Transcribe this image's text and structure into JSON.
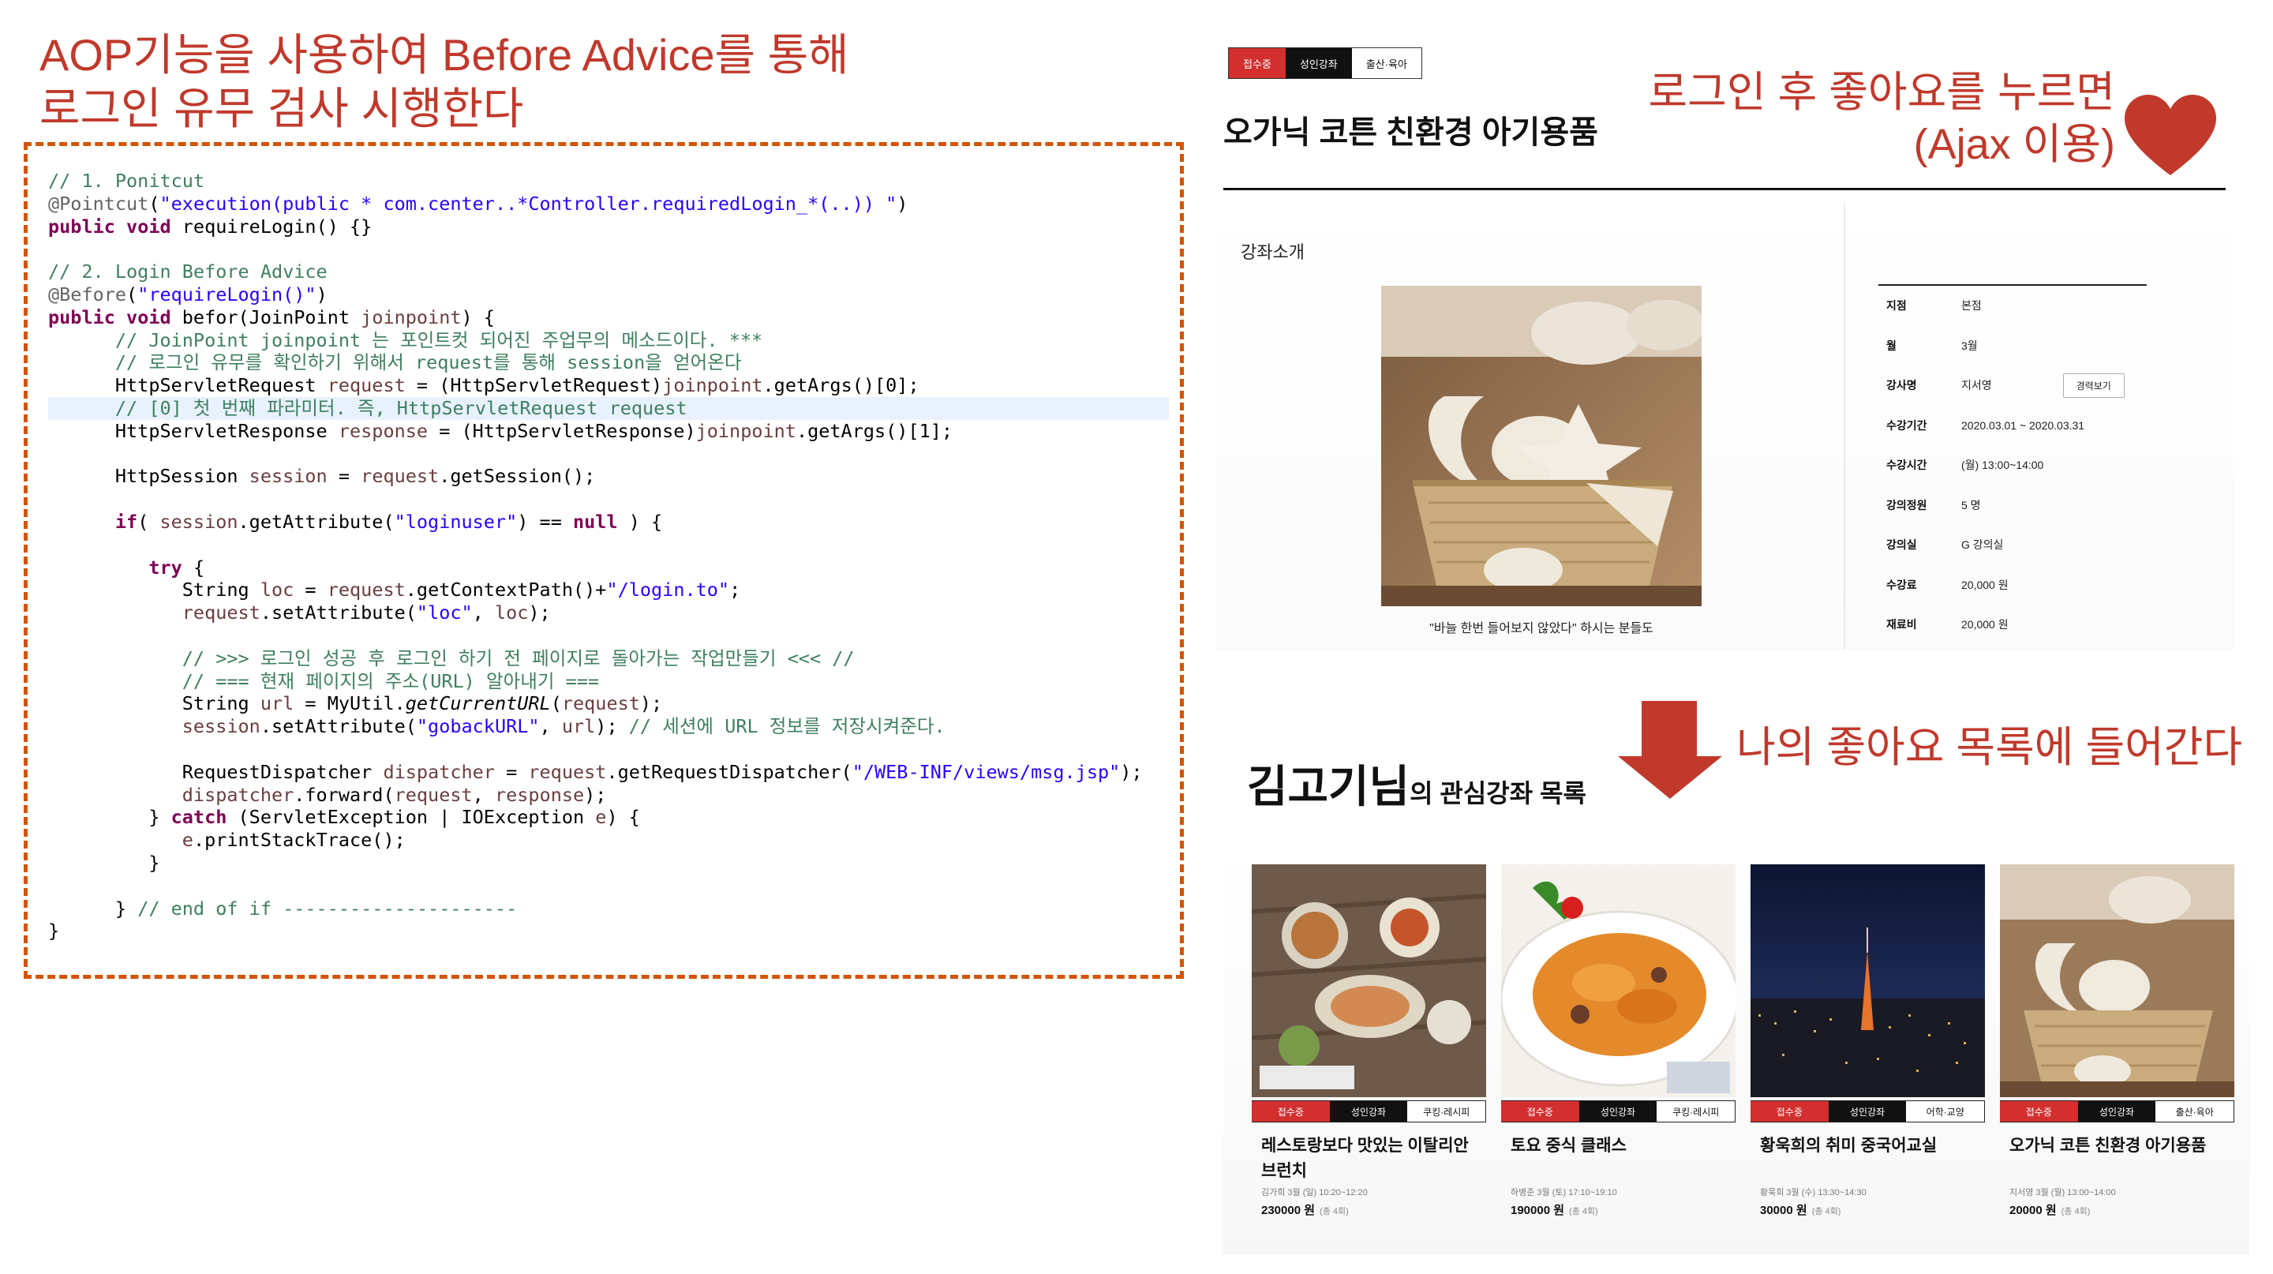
{
  "slide_title": {
    "line1": "AOP기능을 사용하여 Before Advice를 통해",
    "line2": "로그인 유무 검사 시행한다"
  },
  "code_lines": [
    "// 1. Ponitcut",
    "@Pointcut(\"execution(public * com.center..*Controller.requiredLogin_*(..)) \")",
    "public void requireLogin() {}",
    "",
    "// 2. Login Before Advice",
    "@Before(\"requireLogin()\")",
    "public void befor(JoinPoint joinpoint) {",
    "      // JoinPoint joinpoint 는 포인트컷 되어진 주업무의 메소드이다. ***",
    "      // 로그인 유무를 확인하기 위해서 request를 통해 session을 얻어온다",
    "      HttpServletRequest request = (HttpServletRequest)joinpoint.getArgs()[0];",
    "      // [0] 첫 번째 파라미터. 즉, HttpServletRequest request",
    "      HttpServletResponse response = (HttpServletResponse)joinpoint.getArgs()[1];",
    "",
    "      HttpSession session = request.getSession();",
    "",
    "      if( session.getAttribute(\"loginuser\") == null ) {",
    "",
    "         try {",
    "            String loc = request.getContextPath()+\"/login.to\";",
    "            request.setAttribute(\"loc\", loc);",
    "",
    "            // >>> 로그인 성공 후 로그인 하기 전 페이지로 돌아가는 작업만들기 <<< //",
    "            // === 현재 페이지의 주소(URL) 알아내기 ===",
    "            String url = MyUtil.getCurrentURL(request);",
    "            session.setAttribute(\"gobackURL\", url); // 세션에 URL 정보를 저장시켜준다.",
    "",
    "            RequestDispatcher dispatcher = request.getRequestDispatcher(\"/WEB-INF/views/msg.jsp\");",
    "            dispatcher.forward(request, response);",
    "         } catch (ServletException | IOException e) {",
    "            e.printStackTrace();",
    "         }",
    "",
    "      } // end of if ---------------------",
    "}"
  ],
  "product": {
    "tags": [
      "접수중",
      "성인강좌",
      "출산·육아"
    ],
    "title": "오가닉 코튼 친환경 아기용품",
    "section_label": "강좌소개",
    "image_caption": "\"바늘 한번 들어보지 않았다\" 하시는 분들도",
    "career_button": "경력보기",
    "info": [
      {
        "key": "지점",
        "value": "본점"
      },
      {
        "key": "월",
        "value": "3월"
      },
      {
        "key": "강사명",
        "value": "지서영"
      },
      {
        "key": "수강기간",
        "value": "2020.03.01 ~ 2020.03.31"
      },
      {
        "key": "수강시간",
        "value": "(월) 13:00~14:00"
      },
      {
        "key": "강의정원",
        "value": "5 명"
      },
      {
        "key": "강의실",
        "value": "G 강의실"
      },
      {
        "key": "수강료",
        "value": "20,000 원"
      },
      {
        "key": "재료비",
        "value": "20,000 원"
      }
    ]
  },
  "notes": {
    "like_line1": "로그인 후 좋아요를 누르면",
    "like_line2": "(Ajax 이용)",
    "go_to_list": "나의 좋아요 목록에 들어간다"
  },
  "favorites": {
    "user_name": "김고기님",
    "suffix": "의 관심강좌 목록",
    "cards": [
      {
        "tags": [
          "접수중",
          "성인강좌",
          "쿠킹·레시피"
        ],
        "title": "레스토랑보다 맛있는 이탈리안 브런치",
        "meta": "김가희  3월  (일)  10:20~12:20",
        "price": "230000 원",
        "count": "(총 4회)"
      },
      {
        "tags": [
          "접수중",
          "성인강좌",
          "쿠킹·레시피"
        ],
        "title": "토요 중식 클래스",
        "meta": "하병준  3월  (토)  17:10~19:10",
        "price": "190000 원",
        "count": "(총 4회)"
      },
      {
        "tags": [
          "접수중",
          "성인강좌",
          "어학·교양"
        ],
        "title": "황욱희의 취미 중국어교실",
        "meta": "황욱희  3월  (수)  13:30~14:30",
        "price": "30000 원",
        "count": "(총 4회)"
      },
      {
        "tags": [
          "접수중",
          "성인강좌",
          "출산·육아"
        ],
        "title": "오가닉 코튼 친환경 아기용품",
        "meta": "지서영  3월  (월)  13:00~14:00",
        "price": "20000 원",
        "count": "(총 4회)"
      }
    ]
  },
  "colors": {
    "accent_red": "#c0392b",
    "tag_red": "#d32f2f",
    "heart": "#c0392b"
  }
}
